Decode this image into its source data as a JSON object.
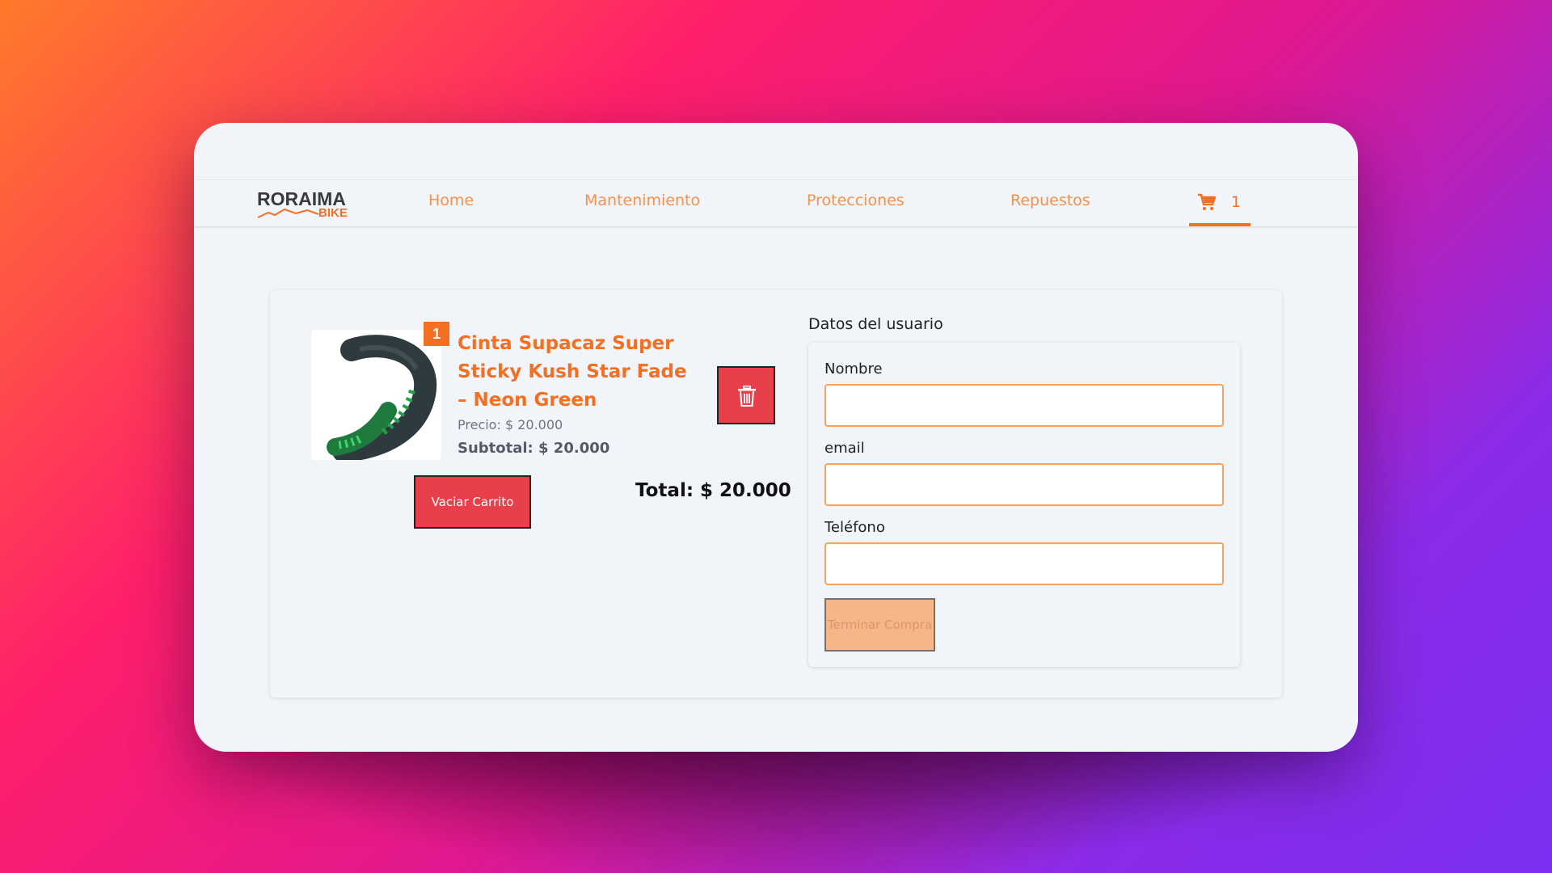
{
  "brand": {
    "logo_main": "RORAIMA",
    "logo_sub": "BIKE"
  },
  "nav": {
    "items": [
      {
        "label": "Home"
      },
      {
        "label": "Mantenimiento"
      },
      {
        "label": "Protecciones"
      },
      {
        "label": "Repuestos"
      }
    ],
    "cart_icon": "cart-icon",
    "cart_count": "1"
  },
  "cart": {
    "item": {
      "quantity": "1",
      "name": "Cinta Supacaz Super Sticky Kush Star Fade – Neon Green",
      "price": "Precio: $ 20.000",
      "subtotal": "Subtotal: $ 20.000",
      "image_icon": "handlebar-tape-image"
    },
    "delete_icon": "trash-icon",
    "empty_label": "Vaciar Carrito",
    "total": "Total: $ 20.000"
  },
  "form": {
    "title": "Datos del usuario",
    "fields": [
      {
        "label": "Nombre",
        "value": ""
      },
      {
        "label": "email",
        "value": ""
      },
      {
        "label": "Teléfono",
        "value": ""
      }
    ],
    "submit_label": "Terminar Compra"
  },
  "colors": {
    "accent": "#f36f21",
    "nav_link": "#f4914a",
    "danger": "#e8404a",
    "disabled_button": "#f6b68a",
    "page_bg": "#f1f4f8"
  }
}
